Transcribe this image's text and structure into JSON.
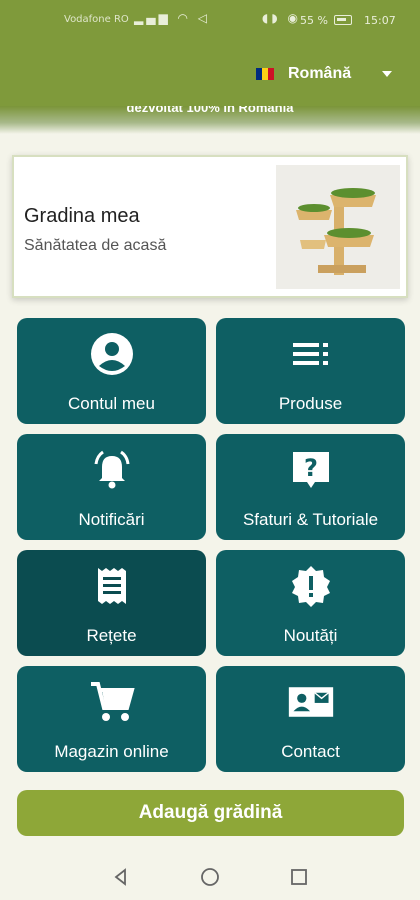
{
  "status_bar": {
    "carrier": "Vodafone RO",
    "battery": "55 %",
    "time": "15:07"
  },
  "header": {
    "language_label": "Română",
    "flag_colors": [
      "#002b7f",
      "#fcd116",
      "#ce1126"
    ],
    "banner_text": "dezvoltat 100% în România"
  },
  "hero": {
    "title": "Gradina mea",
    "subtitle": "Sănătatea de acasă",
    "image_icon": "tiered-microgreens-planter"
  },
  "menu": {
    "items": [
      {
        "label": "Contul meu",
        "icon": "account-icon"
      },
      {
        "label": "Produse",
        "icon": "list-icon"
      },
      {
        "label": "Notificări",
        "icon": "bell-icon"
      },
      {
        "label": "Sfaturi & Tutoriale",
        "icon": "help-icon"
      },
      {
        "label": "Rețete",
        "icon": "receipt-icon"
      },
      {
        "label": "Noutăți",
        "icon": "alert-badge-icon"
      },
      {
        "label": "Magazin online",
        "icon": "cart-icon"
      },
      {
        "label": "Contact",
        "icon": "contact-card-icon"
      }
    ]
  },
  "actions": {
    "add_garden_label": "Adaugă grădină"
  },
  "colors": {
    "header_green": "#7f9a3b",
    "tile_teal": "#0e5f63",
    "tile_pressed": "#0b4c50",
    "button_green": "#8ea738",
    "background": "#f4f4ea"
  }
}
